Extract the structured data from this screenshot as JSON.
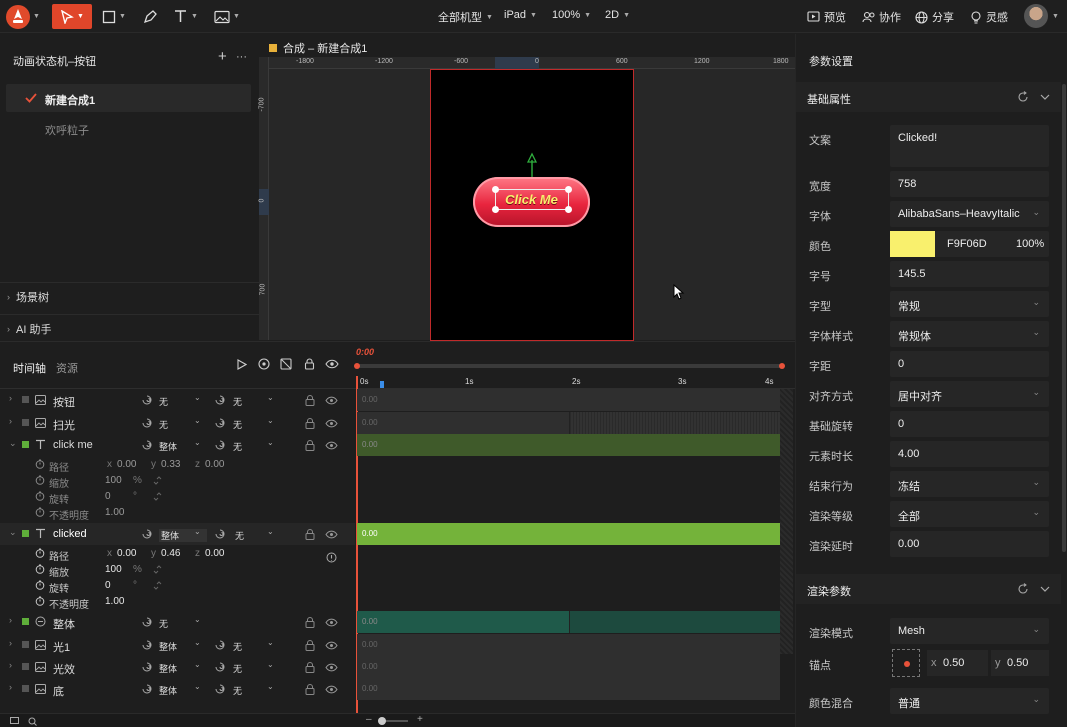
{
  "topbar": {
    "device": "全部机型",
    "ipad": "iPad",
    "zoom": "100%",
    "mode": "2D",
    "preview": "预览",
    "collab": "协作",
    "share": "分享",
    "lingsu": "灵感"
  },
  "left": {
    "title": "动画状态机–按钮",
    "items": [
      {
        "label": "新建合成1",
        "active": true
      },
      {
        "label": "欢呼粒子",
        "active": false
      }
    ],
    "scene_tree": "场景树",
    "ai": "AI 助手"
  },
  "canvas": {
    "tab": "合成 – 新建合成1",
    "ruler_h": [
      "-1800",
      "-1200",
      "-600",
      "0",
      "600",
      "1200",
      "1800"
    ],
    "ruler_v": [
      "-700",
      "0",
      "700"
    ],
    "button_text": "Click Me"
  },
  "right": {
    "title": "参数设置",
    "basic_header": "基础属性",
    "text_label": "文案",
    "text_value": "Clicked!",
    "width_label": "宽度",
    "width_value": "758",
    "font_label": "字体",
    "font_value": "AlibabaSans–HeavyItalic",
    "color_label": "颜色",
    "color_hex": "F9F06D",
    "color_swatch": "#f9f06d",
    "color_opacity": "100%",
    "size_label": "字号",
    "size_value": "145.5",
    "style_label": "字型",
    "style_value": "常规",
    "fstyle_label": "字体样式",
    "fstyle_value": "常规体",
    "spacing_label": "字距",
    "spacing_value": "0",
    "align_label": "对齐方式",
    "align_value": "居中对齐",
    "rot_label": "基础旋转",
    "rot_value": "0",
    "dur_label": "元素时长",
    "dur_value": "4.00",
    "end_label": "结束行为",
    "end_value": "冻结",
    "level_label": "渲染等级",
    "level_value": "全部",
    "delay_label": "渲染延时",
    "delay_value": "0.00",
    "render_header": "渲染参数",
    "rmode_label": "渲染模式",
    "rmode_value": "Mesh",
    "anchor_label": "锚点",
    "anchor_x_label": "x",
    "anchor_x": "0.50",
    "anchor_y_label": "y",
    "anchor_y": "0.50",
    "blend_label": "颜色混合",
    "blend_value": "普通"
  },
  "timeline": {
    "tab_timeline": "时间轴",
    "tab_assets": "资源",
    "time": "0:00",
    "ticks": [
      "0s",
      "1s",
      "2s",
      "3s",
      "4s"
    ],
    "layers": [
      {
        "name": "按钮",
        "a": "无",
        "b": "无",
        "track": "0.00"
      },
      {
        "name": "扫光",
        "a": "无",
        "b": "无",
        "track": "0.00"
      },
      {
        "name": "click me",
        "a": "整体",
        "b": "无",
        "track": "0.00"
      },
      {
        "name": "clicked",
        "a": "整体",
        "b": "无",
        "track": "0.00"
      },
      {
        "name": "整体",
        "a": "无",
        "track": "0.00"
      },
      {
        "name": "光1",
        "a": "整体",
        "b": "无",
        "track": "0.00"
      },
      {
        "name": "光效",
        "a": "整体",
        "b": "无",
        "track": "0.00"
      },
      {
        "name": "底",
        "a": "整体",
        "b": "无",
        "track": "0.00"
      }
    ],
    "props1": {
      "path": "路径",
      "px": "x",
      "pxv": "0.00",
      "py": "y",
      "pyv": "0.33",
      "pz": "z",
      "pzv": "0.00",
      "scale": "缩放",
      "scalev": "100",
      "pct": "%",
      "rotate": "旋转",
      "rotatev": "0",
      "deg": "°",
      "opacity": "不透明度",
      "opacityv": "1.00"
    },
    "props2": {
      "path": "路径",
      "px": "x",
      "pxv": "0.00",
      "py": "y",
      "pyv": "0.46",
      "pz": "z",
      "pzv": "0.00",
      "scale": "缩放",
      "scalev": "100",
      "pct": "%",
      "rotate": "旋转",
      "rotatev": "0",
      "deg": "°",
      "opacity": "不透明度",
      "opacityv": "1.00"
    }
  }
}
